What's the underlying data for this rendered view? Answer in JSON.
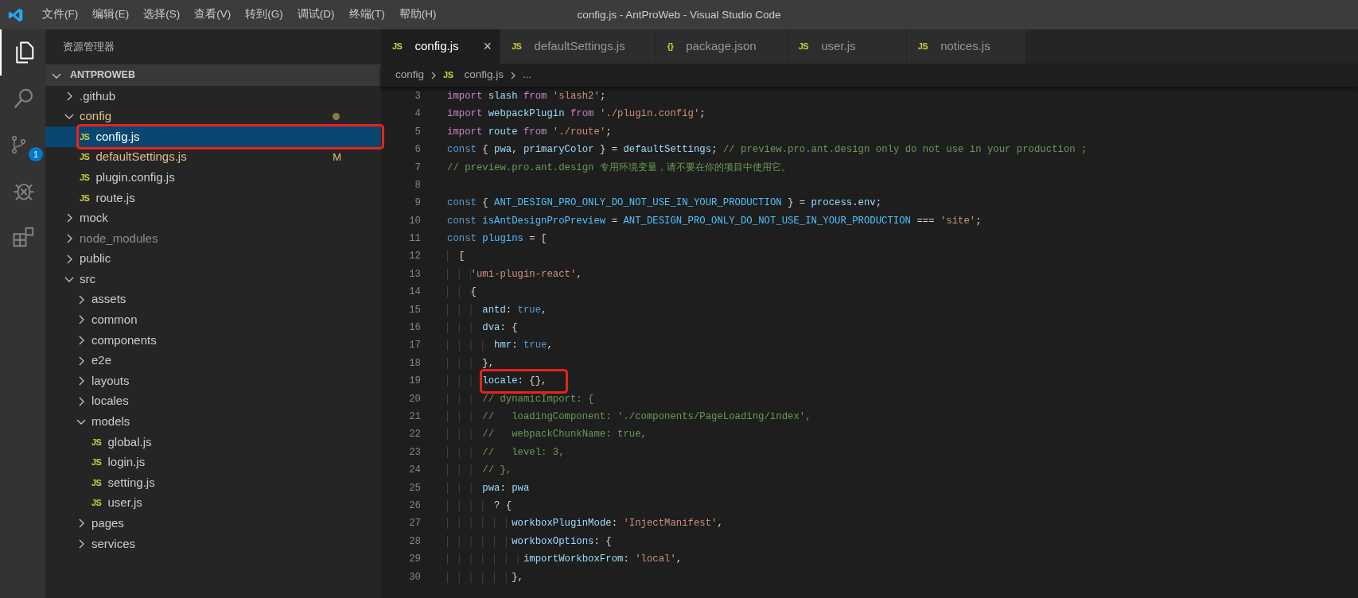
{
  "window": {
    "title": "config.js - AntProWeb - Visual Studio Code"
  },
  "menu": [
    "文件(F)",
    "编辑(E)",
    "选择(S)",
    "查看(V)",
    "转到(G)",
    "调试(D)",
    "终端(T)",
    "帮助(H)"
  ],
  "activity_bar": [
    {
      "kind": "explorer",
      "selected": true
    },
    {
      "kind": "search",
      "selected": false
    },
    {
      "kind": "scm",
      "selected": false,
      "badge": "1"
    },
    {
      "kind": "debug",
      "selected": false
    },
    {
      "kind": "extensions",
      "selected": false
    }
  ],
  "sidebar": {
    "title": "资源管理器",
    "section": {
      "title": "ANTPROWEB",
      "expanded": true
    },
    "tree": [
      {
        "name": ".github",
        "kind": "folder",
        "expanded": false,
        "selected": false,
        "modified": false,
        "ignored": false
      },
      {
        "name": "config",
        "kind": "folder",
        "expanded": true,
        "selected": false,
        "modified": true,
        "ignored": false,
        "children": [
          {
            "name": "config.js",
            "icon": "JS",
            "kind": "file",
            "selected": true,
            "modified": false,
            "ignored": false,
            "annotated": true
          },
          {
            "name": "defaultSettings.js",
            "icon": "JS",
            "kind": "file",
            "selected": false,
            "modified": true,
            "ignored": false,
            "badge": "M"
          },
          {
            "name": "plugin.config.js",
            "icon": "JS",
            "kind": "file",
            "selected": false,
            "modified": false,
            "ignored": false
          },
          {
            "name": "route.js",
            "icon": "JS",
            "kind": "file",
            "selected": false,
            "modified": false,
            "ignored": false
          }
        ]
      },
      {
        "name": "mock",
        "kind": "folder",
        "expanded": false,
        "selected": false,
        "modified": false,
        "ignored": false
      },
      {
        "name": "node_modules",
        "kind": "folder",
        "expanded": false,
        "selected": false,
        "modified": false,
        "ignored": true
      },
      {
        "name": "public",
        "kind": "folder",
        "expanded": false,
        "selected": false,
        "modified": false,
        "ignored": false
      },
      {
        "name": "src",
        "kind": "folder",
        "expanded": true,
        "selected": false,
        "modified": false,
        "ignored": false,
        "children": [
          {
            "name": "assets",
            "kind": "folder",
            "expanded": false,
            "selected": false,
            "modified": false,
            "ignored": false
          },
          {
            "name": "common",
            "kind": "folder",
            "expanded": false,
            "selected": false,
            "modified": false,
            "ignored": false
          },
          {
            "name": "components",
            "kind": "folder",
            "expanded": false,
            "selected": false,
            "modified": false,
            "ignored": false
          },
          {
            "name": "e2e",
            "kind": "folder",
            "expanded": false,
            "selected": false,
            "modified": false,
            "ignored": false
          },
          {
            "name": "layouts",
            "kind": "folder",
            "expanded": false,
            "selected": false,
            "modified": false,
            "ignored": false
          },
          {
            "name": "locales",
            "kind": "folder",
            "expanded": false,
            "selected": false,
            "modified": false,
            "ignored": false
          },
          {
            "name": "models",
            "kind": "folder",
            "expanded": true,
            "selected": false,
            "modified": false,
            "ignored": false,
            "children": [
              {
                "name": "global.js",
                "icon": "JS",
                "kind": "file",
                "selected": false,
                "modified": false,
                "ignored": false
              },
              {
                "name": "login.js",
                "icon": "JS",
                "kind": "file",
                "selected": false,
                "modified": false,
                "ignored": false
              },
              {
                "name": "setting.js",
                "icon": "JS",
                "kind": "file",
                "selected": false,
                "modified": false,
                "ignored": false
              },
              {
                "name": "user.js",
                "icon": "JS",
                "kind": "file",
                "selected": false,
                "modified": false,
                "ignored": false
              }
            ]
          },
          {
            "name": "pages",
            "kind": "folder",
            "expanded": false,
            "selected": false,
            "modified": false,
            "ignored": false
          },
          {
            "name": "services",
            "kind": "folder",
            "expanded": false,
            "selected": false,
            "modified": false,
            "ignored": false
          }
        ]
      }
    ]
  },
  "tabs": [
    {
      "icon": "JS",
      "label": "config.js",
      "selected": true,
      "close": "×"
    },
    {
      "icon": "JS",
      "label": "defaultSettings.js",
      "selected": false
    },
    {
      "icon": "{}",
      "label": "package.json",
      "selected": false
    },
    {
      "icon": "JS",
      "label": "user.js",
      "selected": false
    },
    {
      "icon": "JS",
      "label": "notices.js",
      "selected": false
    }
  ],
  "breadcrumb": [
    {
      "label": "config"
    },
    {
      "icon": "JS",
      "label": "config.js"
    },
    {
      "label": "..."
    }
  ],
  "code": [
    {
      "number": "3",
      "tokens": [
        {
          "kind": "ctl",
          "text": "import "
        },
        {
          "kind": "var",
          "text": "slash "
        },
        {
          "kind": "ctl",
          "text": "from "
        },
        {
          "kind": "str",
          "text": "'slash2'"
        },
        {
          "kind": "pun",
          "text": ";"
        }
      ]
    },
    {
      "number": "4",
      "tokens": [
        {
          "kind": "ctl",
          "text": "import "
        },
        {
          "kind": "var",
          "text": "webpackPlugin "
        },
        {
          "kind": "ctl",
          "text": "from "
        },
        {
          "kind": "str",
          "text": "'./plugin.config'"
        },
        {
          "kind": "pun",
          "text": ";"
        }
      ]
    },
    {
      "number": "5",
      "tokens": [
        {
          "kind": "ctl",
          "text": "import "
        },
        {
          "kind": "var",
          "text": "route "
        },
        {
          "kind": "ctl",
          "text": "from "
        },
        {
          "kind": "str",
          "text": "'./route'"
        },
        {
          "kind": "pun",
          "text": ";"
        }
      ]
    },
    {
      "number": "6",
      "tokens": [
        {
          "kind": "kw",
          "text": "const "
        },
        {
          "kind": "pun",
          "text": "{ "
        },
        {
          "kind": "var",
          "text": "pwa"
        },
        {
          "kind": "pun",
          "text": ", "
        },
        {
          "kind": "var",
          "text": "primaryColor "
        },
        {
          "kind": "pun",
          "text": "} = "
        },
        {
          "kind": "var",
          "text": "defaultSettings"
        },
        {
          "kind": "pun",
          "text": "; "
        },
        {
          "kind": "cmt",
          "text": "// preview.pro.ant.design only do not use in your production ;"
        }
      ]
    },
    {
      "number": "7",
      "tokens": [
        {
          "kind": "cmt",
          "text": "// preview.pro.ant.design 专用环境变量，请不要在你的项目中使用它。"
        }
      ]
    },
    {
      "number": "8"
    },
    {
      "number": "9",
      "tokens": [
        {
          "kind": "kw",
          "text": "const "
        },
        {
          "kind": "pun",
          "text": "{ "
        },
        {
          "kind": "cst",
          "text": "ANT_DESIGN_PRO_ONLY_DO_NOT_USE_IN_YOUR_PRODUCTION "
        },
        {
          "kind": "pun",
          "text": "} = "
        },
        {
          "kind": "var",
          "text": "process"
        },
        {
          "kind": "pun",
          "text": "."
        },
        {
          "kind": "var",
          "text": "env"
        },
        {
          "kind": "pun",
          "text": ";"
        }
      ]
    },
    {
      "number": "10",
      "tokens": [
        {
          "kind": "kw",
          "text": "const "
        },
        {
          "kind": "cst",
          "text": "isAntDesignProPreview "
        },
        {
          "kind": "pun",
          "text": "= "
        },
        {
          "kind": "cst",
          "text": "ANT_DESIGN_PRO_ONLY_DO_NOT_USE_IN_YOUR_PRODUCTION "
        },
        {
          "kind": "pun",
          "text": "=== "
        },
        {
          "kind": "str",
          "text": "'site'"
        },
        {
          "kind": "pun",
          "text": ";"
        }
      ]
    },
    {
      "number": "11",
      "tokens": [
        {
          "kind": "kw",
          "text": "const "
        },
        {
          "kind": "cst",
          "text": "plugins "
        },
        {
          "kind": "pun",
          "text": "= ["
        }
      ]
    },
    {
      "number": "12",
      "tokens": [
        {
          "kind": "pun",
          "text": "  ["
        }
      ]
    },
    {
      "number": "13",
      "tokens": [
        {
          "kind": "str",
          "text": "    'umi-plugin-react'"
        },
        {
          "kind": "pun",
          "text": ","
        }
      ]
    },
    {
      "number": "14",
      "tokens": [
        {
          "kind": "pun",
          "text": "    {"
        }
      ]
    },
    {
      "number": "15",
      "tokens": [
        {
          "kind": "var",
          "text": "      antd"
        },
        {
          "kind": "pun",
          "text": ": "
        },
        {
          "kind": "kw",
          "text": "true"
        },
        {
          "kind": "pun",
          "text": ","
        }
      ]
    },
    {
      "number": "16",
      "tokens": [
        {
          "kind": "var",
          "text": "      dva"
        },
        {
          "kind": "pun",
          "text": ": {"
        }
      ]
    },
    {
      "number": "17",
      "tokens": [
        {
          "kind": "var",
          "text": "        hmr"
        },
        {
          "kind": "pun",
          "text": ": "
        },
        {
          "kind": "kw",
          "text": "true"
        },
        {
          "kind": "pun",
          "text": ","
        }
      ]
    },
    {
      "number": "18",
      "tokens": [
        {
          "kind": "pun",
          "text": "      },"
        }
      ]
    },
    {
      "number": "19",
      "annotated": true,
      "tokens": [
        {
          "kind": "var",
          "text": "      locale"
        },
        {
          "kind": "pun",
          "text": ": {},"
        }
      ]
    },
    {
      "number": "20",
      "tokens": [
        {
          "kind": "cmt",
          "text": "      // dynamicImport: {"
        }
      ]
    },
    {
      "number": "21",
      "tokens": [
        {
          "kind": "cmt",
          "text": "      //   loadingComponent: './components/PageLoading/index',"
        }
      ]
    },
    {
      "number": "22",
      "tokens": [
        {
          "kind": "cmt",
          "text": "      //   webpackChunkName: true,"
        }
      ]
    },
    {
      "number": "23",
      "tokens": [
        {
          "kind": "cmt",
          "text": "      //   level: 3,"
        }
      ]
    },
    {
      "number": "24",
      "tokens": [
        {
          "kind": "cmt",
          "text": "      // },"
        }
      ]
    },
    {
      "number": "25",
      "tokens": [
        {
          "kind": "var",
          "text": "      pwa"
        },
        {
          "kind": "pun",
          "text": ": "
        },
        {
          "kind": "var",
          "text": "pwa"
        }
      ]
    },
    {
      "number": "26",
      "tokens": [
        {
          "kind": "pun",
          "text": "        ? {"
        }
      ]
    },
    {
      "number": "27",
      "tokens": [
        {
          "kind": "var",
          "text": "           workboxPluginMode"
        },
        {
          "kind": "pun",
          "text": ": "
        },
        {
          "kind": "str",
          "text": "'InjectManifest'"
        },
        {
          "kind": "pun",
          "text": ","
        }
      ]
    },
    {
      "number": "28",
      "tokens": [
        {
          "kind": "var",
          "text": "           workboxOptions"
        },
        {
          "kind": "pun",
          "text": ": {"
        }
      ]
    },
    {
      "number": "29",
      "tokens": [
        {
          "kind": "var",
          "text": "             importWorkboxFrom"
        },
        {
          "kind": "pun",
          "text": ": "
        },
        {
          "kind": "str",
          "text": "'local'"
        },
        {
          "kind": "pun",
          "text": ","
        }
      ]
    },
    {
      "number": "30",
      "tokens": [
        {
          "kind": "pun",
          "text": "           },"
        }
      ]
    }
  ]
}
